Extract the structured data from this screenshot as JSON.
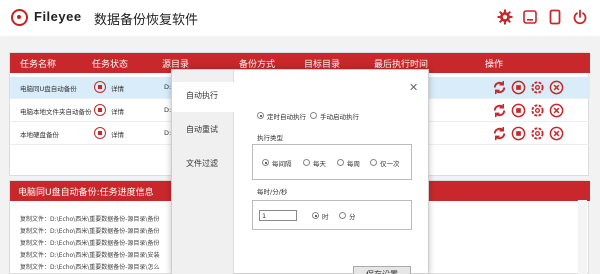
{
  "app": {
    "brand": "Fileyee",
    "title": "数据备份恢复软件",
    "accent": "#c8282b"
  },
  "table": {
    "headers": [
      "任务名称",
      "任务状态",
      "源目录",
      "备份方式",
      "目标目录",
      "最后执行时间",
      "操作"
    ],
    "rows": [
      {
        "name": "电脑同U盘自动备份",
        "detail": "详情",
        "src": "D:"
      },
      {
        "name": "电脑本地文件夹自动备份",
        "detail": "详情",
        "src": "D:"
      },
      {
        "name": "本地硬盘备份",
        "detail": "详情",
        "src": "D:"
      }
    ]
  },
  "log": {
    "title": "电脑同U盘自动备份:任务进度信息",
    "lines": [
      "复制文件：D:\\Echo\\西米\\重要数据备份-源目录\\备份",
      "复制文件：D:\\Echo\\西米\\重要数据备份-源目录\\备份",
      "复制文件：D:\\Echo\\西米\\重要数据备份-源目录\\备份",
      "复制文件：D:\\Echo\\西米\\重要数据备份-源目录\\安装",
      "复制文件：D:\\Echo\\西米\\重要数据备份-源目录\\怎么"
    ]
  },
  "dialog": {
    "tabs": [
      "自动执行",
      "自动重试",
      "文件过滤"
    ],
    "mode_options": [
      "定时自动执行",
      "手动启动执行"
    ],
    "exec_type_label": "执行类型",
    "exec_types": [
      "每间隔",
      "每天",
      "每周",
      "仅一次"
    ],
    "interval_label": "每时/分/秒",
    "interval_value": "1",
    "units": [
      "时",
      "分"
    ],
    "save_label": "保存设置",
    "close_glyph": "✕"
  }
}
